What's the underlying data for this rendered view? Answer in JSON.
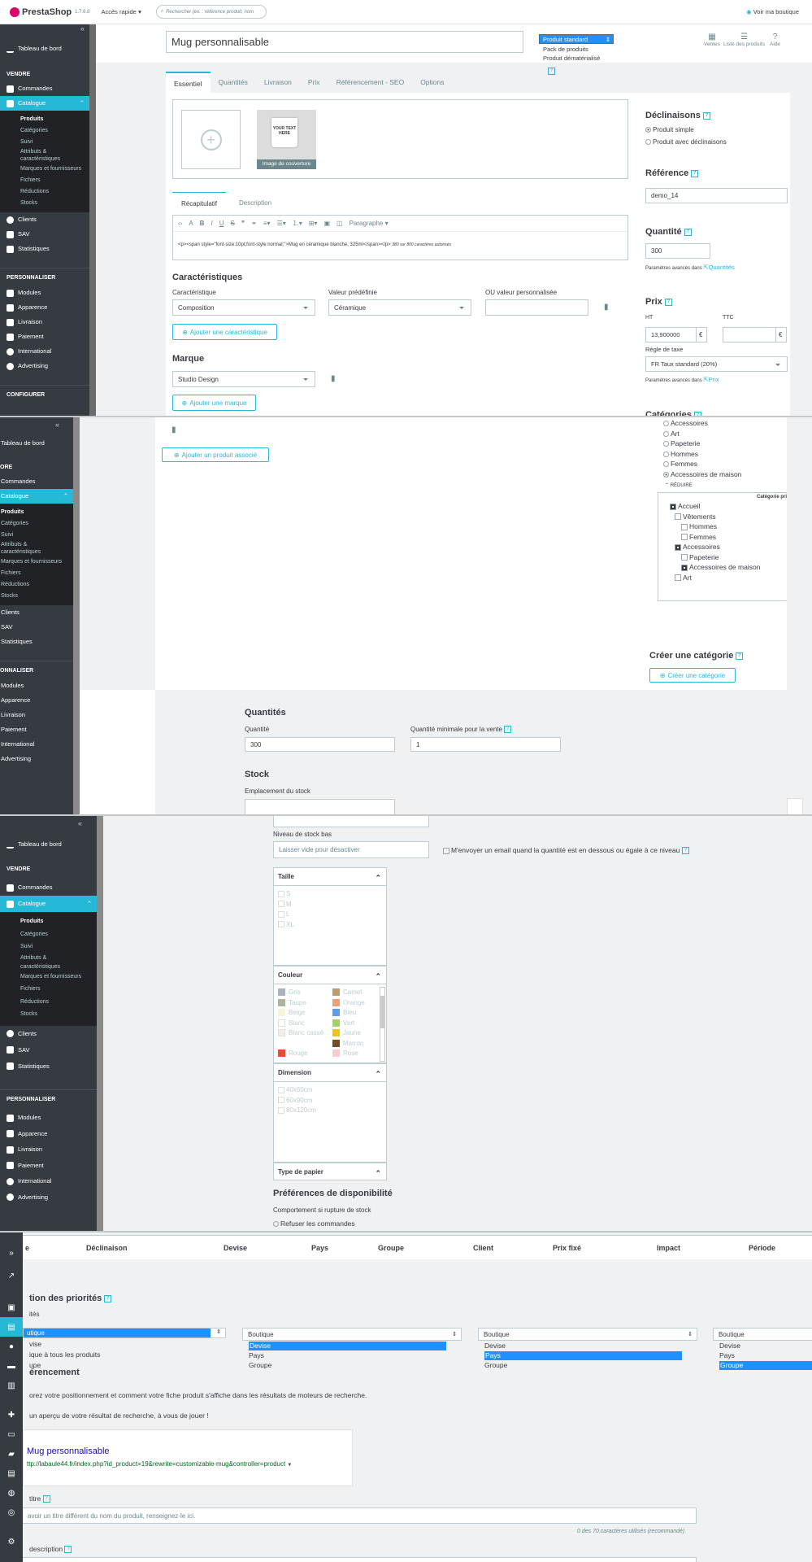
{
  "header": {
    "logo": "PrestaShop",
    "version": "1.7.6.8",
    "quick_access": "Accès rapide ▾",
    "search_placeholder": "Rechercher (ex. : référence produit, nom",
    "view_shop": "Voir ma boutique"
  },
  "product": {
    "name": "Mug personnalisable",
    "type_options": [
      "Produit standard",
      "Pack de produits",
      "Produit dématérialisé"
    ],
    "type_selected": "Produit standard",
    "top_actions": [
      "Ventes",
      "Liste des produits",
      "Aide"
    ]
  },
  "sidebar": {
    "dashboard": "Tableau de bord",
    "groups": [
      "VENDRE",
      "PERSONNALISER",
      "CONFIGURER"
    ],
    "vendre": [
      "Commandes",
      "Catalogue",
      "Clients",
      "SAV",
      "Statistiques"
    ],
    "catalogue_sub": [
      "Produits",
      "Catégories",
      "Suivi",
      "Attributs &",
      "caractéristiques",
      "Marques et fournisseurs",
      "Fichiers",
      "Réductions",
      "Stocks"
    ],
    "personnaliser": [
      "Modules",
      "Apparence",
      "Livraison",
      "Paiement",
      "International",
      "Advertising"
    ]
  },
  "tabs": [
    "Essentiel",
    "Quantités",
    "Livraison",
    "Prix",
    "Référencement - SEO",
    "Options"
  ],
  "image": {
    "cover": "Image de couverture"
  },
  "summary": {
    "tabs": [
      "Récapitulatif",
      "Description"
    ],
    "paragraph": "Paragraphe",
    "content": "<p><span style=\"font-size:10pt;font-style:normal;\">Mug en céramique blanche, 325ml</span></p>",
    "limit": "sur 800 caractères autorisés"
  },
  "features": {
    "title": "Caractéristiques",
    "col1": "Caractéristique",
    "col2": "Valeur prédéfinie",
    "col3": "OU valeur personnalisée",
    "feature": "Composition",
    "value": "Céramique",
    "add": "Ajouter une caractéristique"
  },
  "brand": {
    "title": "Marque",
    "value": "Studio Design",
    "add": "Ajouter une marque"
  },
  "right": {
    "declinaisons": "Déclinaisons",
    "simple": "Produit simple",
    "with_comb": "Produit avec déclinaisons",
    "reference_title": "Référence",
    "reference": "demo_14",
    "quantity_title": "Quantité",
    "quantity": "300",
    "advanced": "Paramètres avancés dans",
    "advanced_link_q": "Quantités",
    "price_title": "Prix",
    "ht": "HT",
    "ttc": "TTC",
    "ht_value": "13,900000",
    "currency": "€",
    "tax_rule_label": "Règle de taxe",
    "tax_rule": "FR Taux standard (20%)",
    "advanced_link_p": "Prix",
    "categories_title": "Catégories"
  },
  "section2": {
    "add_related": "Ajouter un produit associé",
    "radio_cats": [
      "Accessoires",
      "Art",
      "Papeterie",
      "Hommes",
      "Femmes",
      "Accessoires de maison"
    ],
    "reduce": "RÉDUIRE",
    "main_cat": "Catégorie pri",
    "tree": [
      "Accueil",
      "Vêtements",
      "Hommes",
      "Femmes",
      "Accessoires",
      "Papeterie",
      "Accessoires de maison",
      "Art"
    ],
    "create_title": "Créer une catégorie",
    "create_btn": "Créer une catégorie",
    "quantities_title": "Quantités",
    "qty_label": "Quantité",
    "qty": "300",
    "min_label": "Quantité minimale pour la vente",
    "min": "1",
    "stock_title": "Stock",
    "location_label": "Emplacement du stock"
  },
  "section3": {
    "low_stock_label": "Niveau de stock bas",
    "low_stock_placeholder": "Laisser vide pour désactiver",
    "email_alert": "M'envoyer un email quand la quantité est en dessous ou égale à ce niveau",
    "taille": {
      "title": "Taille",
      "items": [
        "S",
        "M",
        "L",
        "XL"
      ]
    },
    "couleur": {
      "title": "Couleur",
      "left": [
        "Gris",
        "Taupe",
        "Beige",
        "Blanc",
        "Blanc cassé",
        "Rouge"
      ],
      "right": [
        "Camel",
        "Orange",
        "Bleu",
        "Vert",
        "Jaune",
        "Marron",
        "Rose"
      ]
    },
    "dimension": {
      "title": "Dimension",
      "items": [
        "40x60cm",
        "60x90cm",
        "80x120cm"
      ]
    },
    "papier": "Type de papier",
    "availability_title": "Préférences de disponibilité",
    "oos_label": "Comportement si rupture de stock",
    "refuse": "Refuser les commandes"
  },
  "section4": {
    "cols": [
      "e",
      "Déclinaison",
      "Devise",
      "Pays",
      "Groupe",
      "Client",
      "Prix fixé",
      "Impact",
      "Période"
    ],
    "priority_title": "tion des priorités",
    "priorities": "ités",
    "sel1": "utique",
    "opts1": [
      "vise",
      "ique à tous les produits",
      "upe"
    ],
    "sel": "Boutique",
    "opts": [
      "Devise",
      "Pays",
      "Groupe"
    ],
    "seo_title": "érencement",
    "seo_text1": "orez votre positionnement et comment votre fiche produit s'affiche dans les résultats de moteurs de recherche.",
    "seo_text2": "un aperçu de votre résultat de recherche, à vous de jouer !",
    "preview_title": "Mug personnalisable",
    "preview_url": "ttp://labaule44.fr/index.php?id_product=19&rewrite=customizable-mug&controller=product",
    "meta_title_label": "titre",
    "meta_title_placeholder": "avoir un titre différent du nom du produit, renseignez-le ici.",
    "counter": "0 des 70 caractères utilisés (recommandé)",
    "meta_desc_label": "description"
  },
  "colors": {
    "accent": "#25b9d7",
    "sidebar": "#363a41"
  }
}
